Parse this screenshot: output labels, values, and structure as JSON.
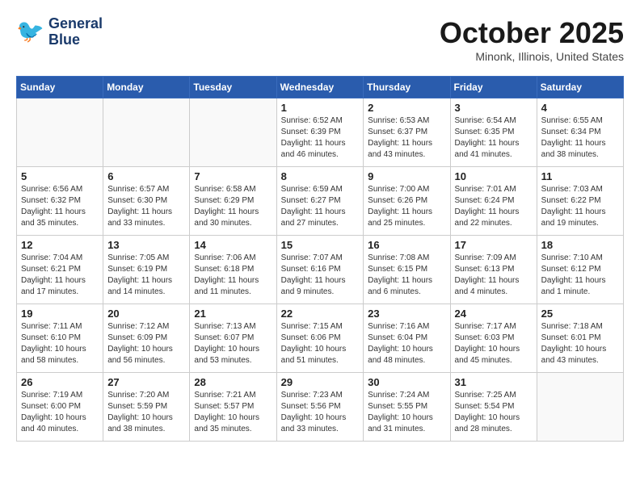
{
  "header": {
    "logo_line1": "General",
    "logo_line2": "Blue",
    "month": "October 2025",
    "location": "Minonk, Illinois, United States"
  },
  "weekdays": [
    "Sunday",
    "Monday",
    "Tuesday",
    "Wednesday",
    "Thursday",
    "Friday",
    "Saturday"
  ],
  "weeks": [
    [
      {
        "day": "",
        "info": ""
      },
      {
        "day": "",
        "info": ""
      },
      {
        "day": "",
        "info": ""
      },
      {
        "day": "1",
        "info": "Sunrise: 6:52 AM\nSunset: 6:39 PM\nDaylight: 11 hours and 46 minutes."
      },
      {
        "day": "2",
        "info": "Sunrise: 6:53 AM\nSunset: 6:37 PM\nDaylight: 11 hours and 43 minutes."
      },
      {
        "day": "3",
        "info": "Sunrise: 6:54 AM\nSunset: 6:35 PM\nDaylight: 11 hours and 41 minutes."
      },
      {
        "day": "4",
        "info": "Sunrise: 6:55 AM\nSunset: 6:34 PM\nDaylight: 11 hours and 38 minutes."
      }
    ],
    [
      {
        "day": "5",
        "info": "Sunrise: 6:56 AM\nSunset: 6:32 PM\nDaylight: 11 hours and 35 minutes."
      },
      {
        "day": "6",
        "info": "Sunrise: 6:57 AM\nSunset: 6:30 PM\nDaylight: 11 hours and 33 minutes."
      },
      {
        "day": "7",
        "info": "Sunrise: 6:58 AM\nSunset: 6:29 PM\nDaylight: 11 hours and 30 minutes."
      },
      {
        "day": "8",
        "info": "Sunrise: 6:59 AM\nSunset: 6:27 PM\nDaylight: 11 hours and 27 minutes."
      },
      {
        "day": "9",
        "info": "Sunrise: 7:00 AM\nSunset: 6:26 PM\nDaylight: 11 hours and 25 minutes."
      },
      {
        "day": "10",
        "info": "Sunrise: 7:01 AM\nSunset: 6:24 PM\nDaylight: 11 hours and 22 minutes."
      },
      {
        "day": "11",
        "info": "Sunrise: 7:03 AM\nSunset: 6:22 PM\nDaylight: 11 hours and 19 minutes."
      }
    ],
    [
      {
        "day": "12",
        "info": "Sunrise: 7:04 AM\nSunset: 6:21 PM\nDaylight: 11 hours and 17 minutes."
      },
      {
        "day": "13",
        "info": "Sunrise: 7:05 AM\nSunset: 6:19 PM\nDaylight: 11 hours and 14 minutes."
      },
      {
        "day": "14",
        "info": "Sunrise: 7:06 AM\nSunset: 6:18 PM\nDaylight: 11 hours and 11 minutes."
      },
      {
        "day": "15",
        "info": "Sunrise: 7:07 AM\nSunset: 6:16 PM\nDaylight: 11 hours and 9 minutes."
      },
      {
        "day": "16",
        "info": "Sunrise: 7:08 AM\nSunset: 6:15 PM\nDaylight: 11 hours and 6 minutes."
      },
      {
        "day": "17",
        "info": "Sunrise: 7:09 AM\nSunset: 6:13 PM\nDaylight: 11 hours and 4 minutes."
      },
      {
        "day": "18",
        "info": "Sunrise: 7:10 AM\nSunset: 6:12 PM\nDaylight: 11 hours and 1 minute."
      }
    ],
    [
      {
        "day": "19",
        "info": "Sunrise: 7:11 AM\nSunset: 6:10 PM\nDaylight: 10 hours and 58 minutes."
      },
      {
        "day": "20",
        "info": "Sunrise: 7:12 AM\nSunset: 6:09 PM\nDaylight: 10 hours and 56 minutes."
      },
      {
        "day": "21",
        "info": "Sunrise: 7:13 AM\nSunset: 6:07 PM\nDaylight: 10 hours and 53 minutes."
      },
      {
        "day": "22",
        "info": "Sunrise: 7:15 AM\nSunset: 6:06 PM\nDaylight: 10 hours and 51 minutes."
      },
      {
        "day": "23",
        "info": "Sunrise: 7:16 AM\nSunset: 6:04 PM\nDaylight: 10 hours and 48 minutes."
      },
      {
        "day": "24",
        "info": "Sunrise: 7:17 AM\nSunset: 6:03 PM\nDaylight: 10 hours and 45 minutes."
      },
      {
        "day": "25",
        "info": "Sunrise: 7:18 AM\nSunset: 6:01 PM\nDaylight: 10 hours and 43 minutes."
      }
    ],
    [
      {
        "day": "26",
        "info": "Sunrise: 7:19 AM\nSunset: 6:00 PM\nDaylight: 10 hours and 40 minutes."
      },
      {
        "day": "27",
        "info": "Sunrise: 7:20 AM\nSunset: 5:59 PM\nDaylight: 10 hours and 38 minutes."
      },
      {
        "day": "28",
        "info": "Sunrise: 7:21 AM\nSunset: 5:57 PM\nDaylight: 10 hours and 35 minutes."
      },
      {
        "day": "29",
        "info": "Sunrise: 7:23 AM\nSunset: 5:56 PM\nDaylight: 10 hours and 33 minutes."
      },
      {
        "day": "30",
        "info": "Sunrise: 7:24 AM\nSunset: 5:55 PM\nDaylight: 10 hours and 31 minutes."
      },
      {
        "day": "31",
        "info": "Sunrise: 7:25 AM\nSunset: 5:54 PM\nDaylight: 10 hours and 28 minutes."
      },
      {
        "day": "",
        "info": ""
      }
    ]
  ]
}
